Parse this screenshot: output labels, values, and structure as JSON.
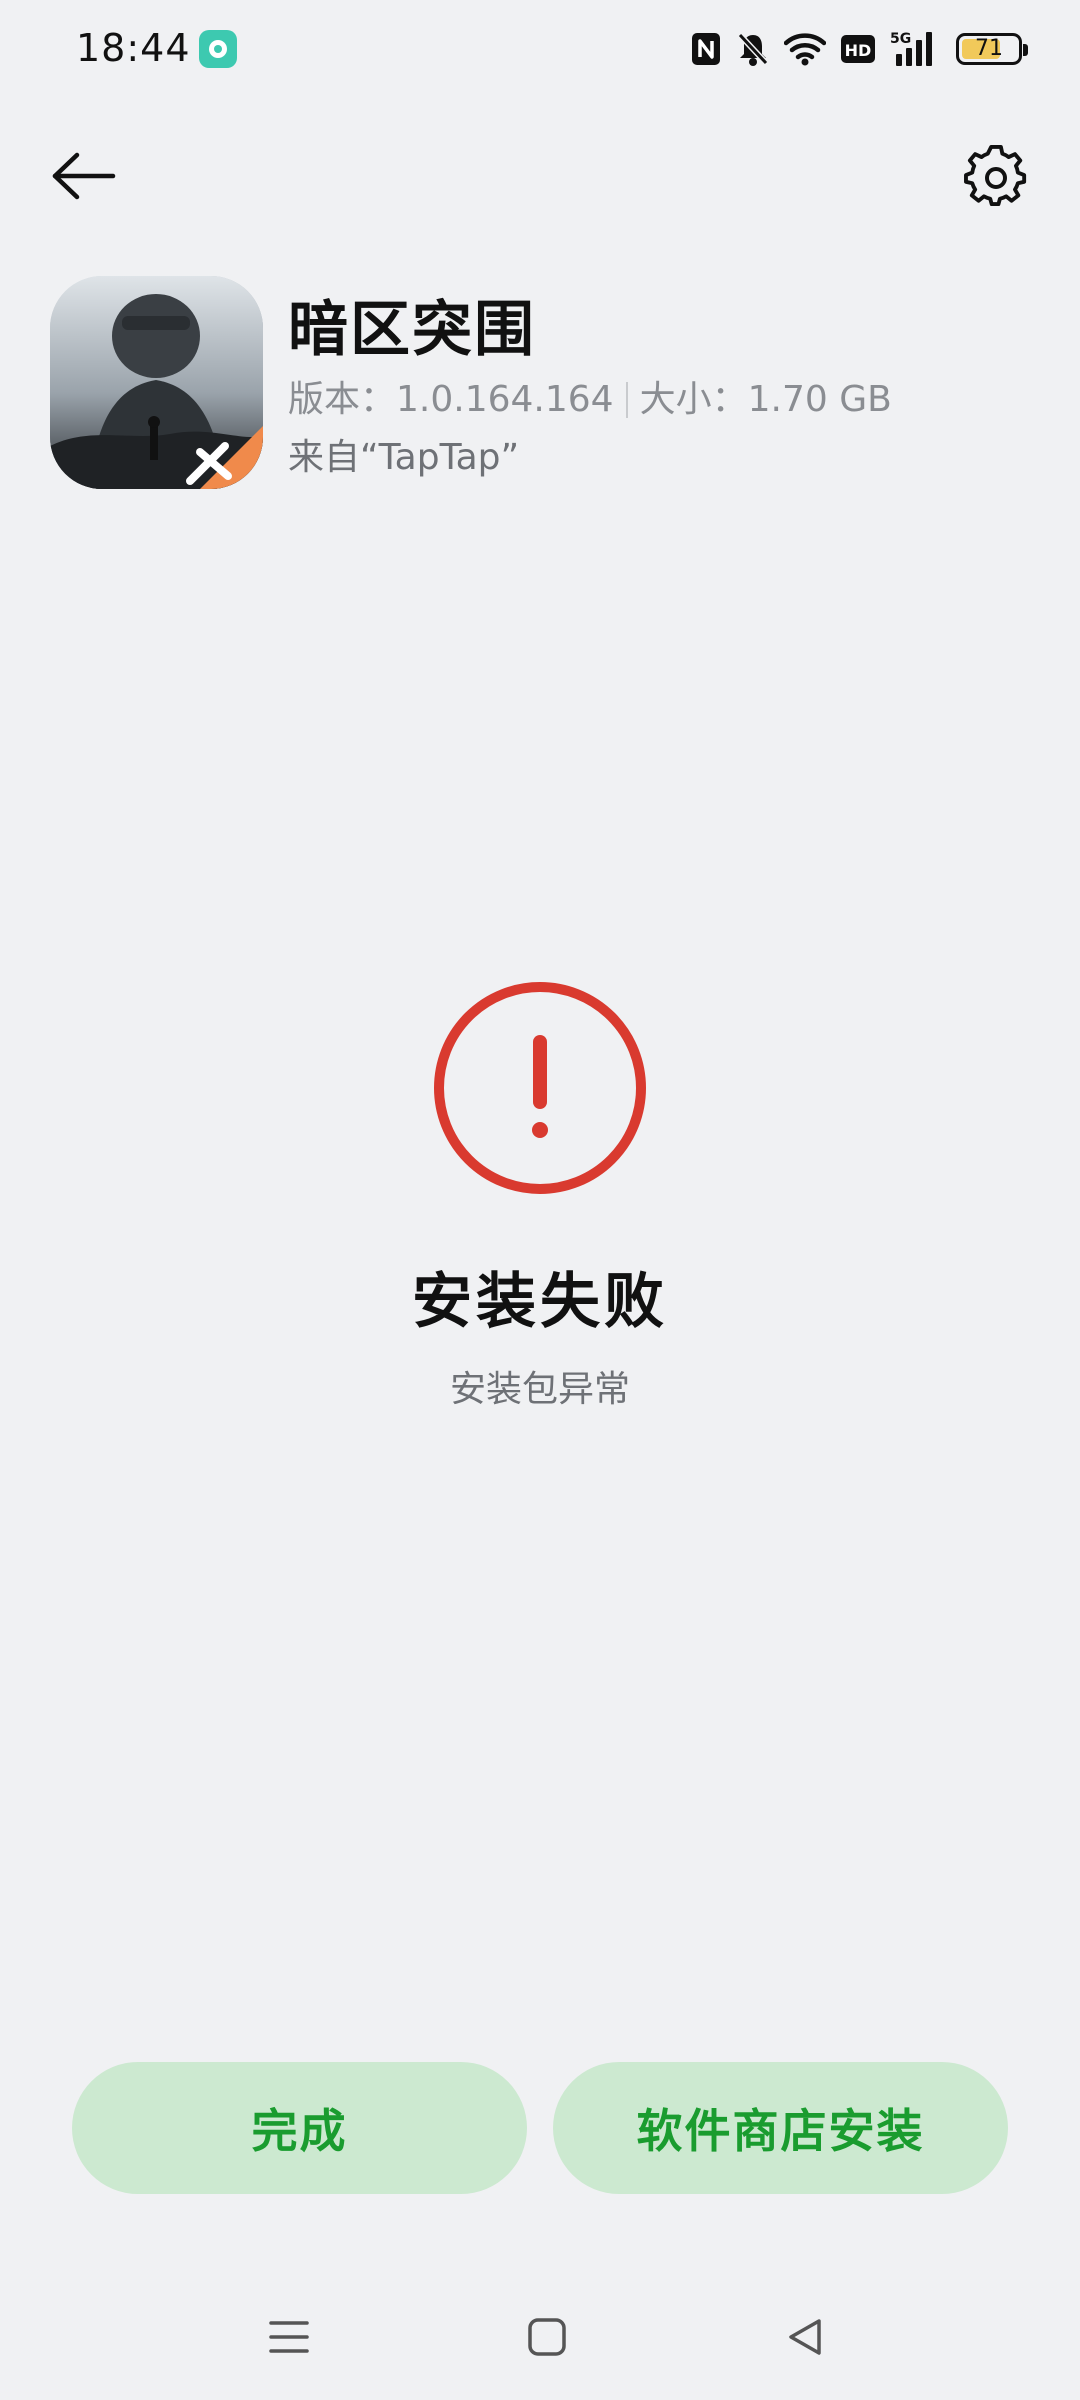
{
  "status_bar": {
    "time": "18:44",
    "battery_level": "71",
    "battery_fraction": 0.71,
    "icons": [
      "nfc-icon",
      "mute-bell-icon",
      "wifi-icon",
      "hd-icon",
      "5g-signal-icon",
      "battery-icon"
    ],
    "notification_icon": "app-notification-icon"
  },
  "header": {
    "back_icon": "arrow-left-icon",
    "settings_icon": "gear-icon"
  },
  "app": {
    "name": "暗区突围",
    "version_label": "版本：",
    "version": "1.0.164.164",
    "size_label": "大小：",
    "size": "1.70 GB",
    "source": "来自“TapTap”"
  },
  "result": {
    "icon": "error-exclamation-icon",
    "title": "安装失败",
    "subtitle": "安装包异常",
    "accent_color": "#d93a2f"
  },
  "actions": {
    "done_label": "完成",
    "store_install_label": "软件商店安装",
    "button_bg": "#cce9d0",
    "button_text_color": "#1a9c2f"
  },
  "nav_bar": {
    "menu_icon": "menu-icon",
    "home_icon": "home-square-icon",
    "back_icon": "back-triangle-icon"
  }
}
